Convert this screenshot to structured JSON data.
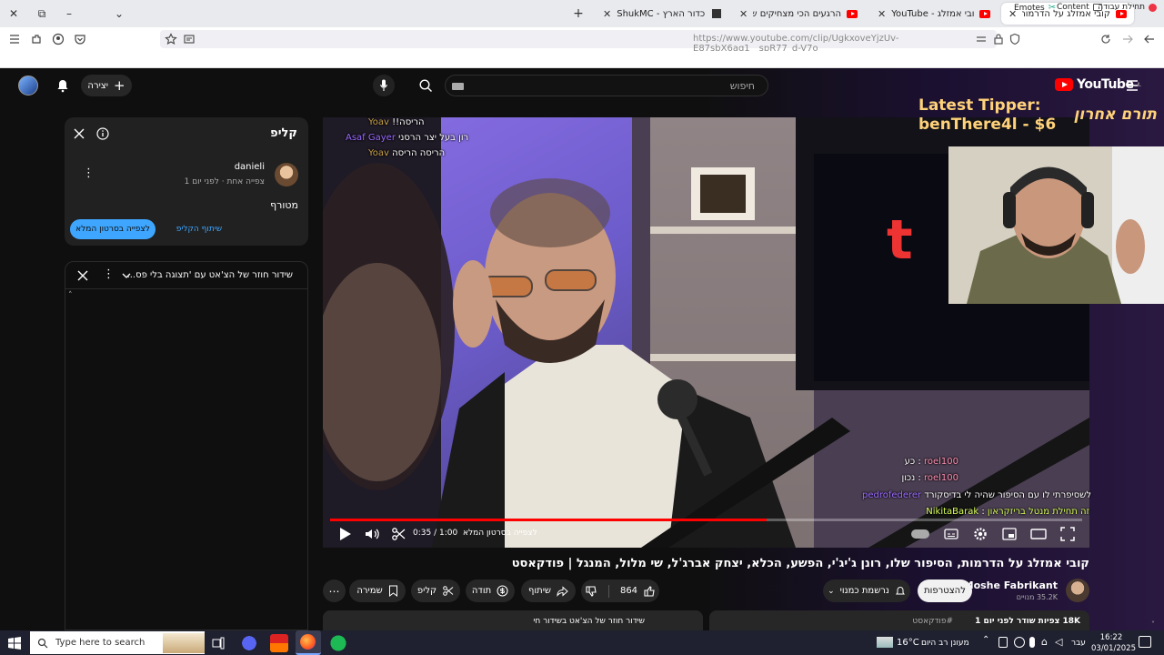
{
  "browser": {
    "tabs": [
      {
        "label": "קובי אמזלג על הדרמות, הסיפור",
        "active": true
      },
      {
        "label": "YouTube - קובי אמזלג",
        "active": false
      },
      {
        "label": "הרגעים הכי מצחיקים של עוזר R",
        "active": false
      },
      {
        "label": "ShukMC - מפת כדור הארץ",
        "active": false
      }
    ],
    "url": "https://www.youtube.com/clip/UgkxoveYjzUv-E87sbX6ag1__spR77_d-V7o",
    "bookmarks": [
      "תחילת עבודה",
      "Content",
      "Emotes"
    ]
  },
  "masthead": {
    "logo_text": "YouTube",
    "logo_region": "IL",
    "search_placeholder": "חיפוש",
    "create_label": "יצירה"
  },
  "clip_panel": {
    "title": "קליפ",
    "author": "danieli",
    "meta": "צפייה אחת · לפני יום 1",
    "clip_title": "מטורף",
    "watch_full_label": "לצפייה בסרטון המלא",
    "share_clip_label": "שיתוף הקליפ"
  },
  "chat_panel": {
    "title": "שידור חוזר של הצ'אט עם 'תצוגה בלי פס..."
  },
  "video": {
    "tipper_line1": "Latest Tipper:",
    "tipper_line2": "benThere4l - $6",
    "tipper_he": "תורם אחרון",
    "top_chat": [
      {
        "user": "Yoav",
        "msg": "הריסה!!",
        "color": "#c9a24a"
      },
      {
        "user": "Asaf Gayer",
        "msg": "רון בעל יצר הרסני",
        "color": "#9b6bff"
      },
      {
        "user": "Yoav",
        "msg": "הריסה הריסה",
        "color": "#c9a24a"
      }
    ],
    "bottom_chat": [
      {
        "user": "roel100",
        "msg": "כע",
        "color": "#ff8fb0"
      },
      {
        "user": "roel100",
        "msg": "נכון",
        "color": "#ff8fb0"
      },
      {
        "user": "pedrofederer",
        "msg": "לשסיפרתי לו עם הסיפור שהיה לי בדיסקורד",
        "color": "#9b6bff"
      },
      {
        "user": "NikitaBarak",
        "msg": "זה תחילת מנטל בריזקראון",
        "color": "#d8ff5a"
      }
    ],
    "time": "0:35 / 1:00",
    "watch_full_label": "לצפייה בסרטון המלא",
    "progress": 0.58
  },
  "below": {
    "title": "קובי אמזלג על הדרמות, הסיפור שלו, רונן ג'יג'י, הפשע, הכלא, יצחק אברג'ל, שי מלול, המנגל | פודקאסט",
    "channel": "Moshe Fabrikant",
    "subs": "35.2K מנויים",
    "subscribe_label": "להצטרפות",
    "subscribed_label": "נרשמת כמנוי",
    "likes": "864",
    "share": "שיתוף",
    "thanks": "תודה",
    "clip": "קליפ",
    "save": "שמירה",
    "desc_stats": "18K צפיות  שודר לפני יום 1",
    "desc_tag": "#פודקאסט",
    "chat_replay_label": "שידור חוזר של הצ'אט בשידור חי"
  },
  "taskbar": {
    "search_placeholder": "Type here to search",
    "temp": "16°C",
    "weather": "מעונן רב היום",
    "lang": "עבר",
    "time": "16:22",
    "date": "03/01/2025"
  }
}
